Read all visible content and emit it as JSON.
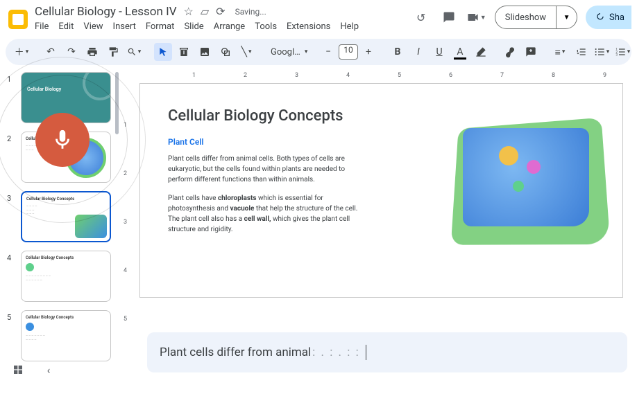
{
  "doc": {
    "title": "Cellular Biology - Lesson IV",
    "saving": "Saving..."
  },
  "menu": {
    "file": "File",
    "edit": "Edit",
    "view": "View",
    "insert": "Insert",
    "format": "Format",
    "slide": "Slide",
    "arrange": "Arrange",
    "tools": "Tools",
    "extensions": "Extensions",
    "help": "Help"
  },
  "actions": {
    "slideshow": "Slideshow",
    "share": "Sha"
  },
  "toolbar": {
    "font": "Googl…",
    "size": "10"
  },
  "ruler": {
    "h": [
      "1",
      "2",
      "3",
      "4",
      "5",
      "6",
      "7",
      "8",
      "9"
    ],
    "v": [
      "1",
      "2",
      "3",
      "4",
      "5"
    ]
  },
  "thumbs": {
    "t1_title": "Cellular Biology",
    "generic_title": "Cellular Biology Concepts"
  },
  "slide": {
    "title": "Cellular Biology Concepts",
    "sub": "Plant Cell",
    "p1": "Plant cells differ from animal cells. Both types of cells are eukaryotic, but the cells found within plants are needed to perform different functions than within animals.",
    "p2a": "Plant cells have ",
    "p2b": "chloroplasts",
    "p2c": " which is essential for photosynthesis and ",
    "p2d": "vacuole",
    "p2e": " that help the structure of the cell. The plant cell also has a ",
    "p2f": "cell wall,",
    "p2g": " which gives the plant cell structure and rigidity."
  },
  "voice": {
    "text": "Plant cells differ from animal",
    "dots": ": . : . : :"
  },
  "nums": {
    "n1": "1",
    "n2": "2",
    "n3": "3",
    "n4": "4",
    "n5": "5"
  }
}
